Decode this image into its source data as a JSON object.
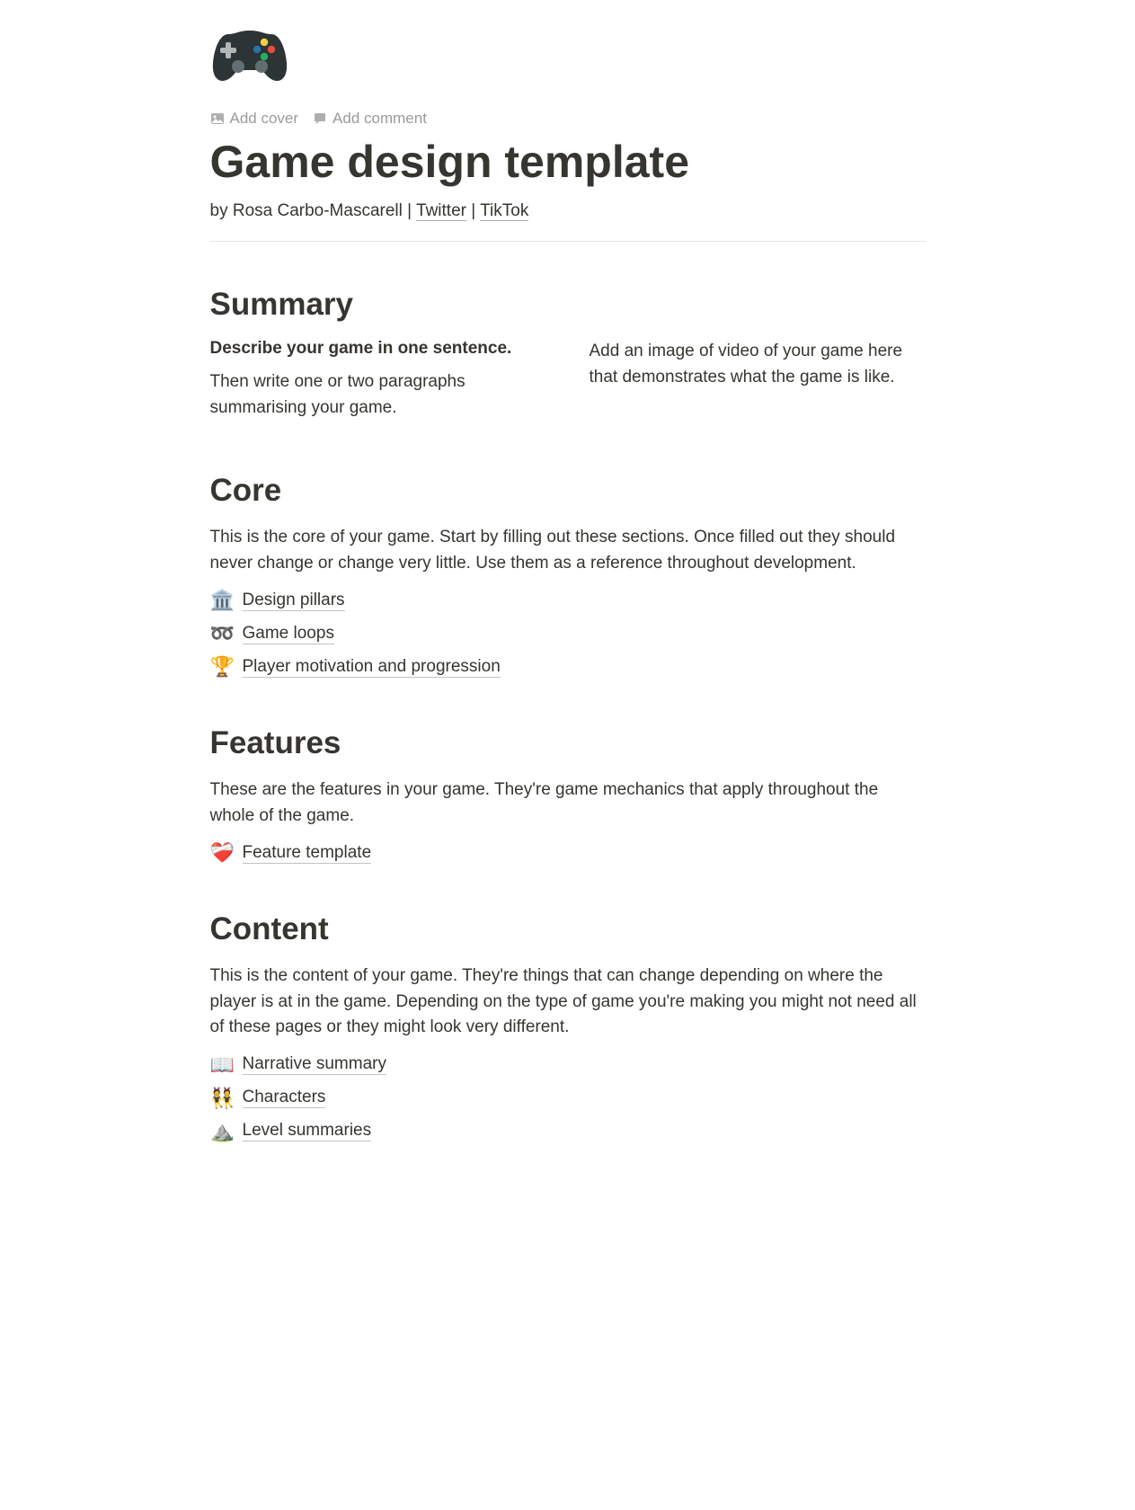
{
  "icon_name": "video-game-controller",
  "actions": {
    "add_cover": "Add cover",
    "add_comment": "Add comment"
  },
  "title": "Game design template",
  "byline": {
    "prefix": "by Rosa Carbo-Mascarell | ",
    "link1": "Twitter",
    "sep": " | ",
    "link2": "TikTok"
  },
  "sections": {
    "summary": {
      "heading": "Summary",
      "left_strong": "Describe your game in one sentence.",
      "left_body": "Then write one or two paragraphs summarising your game.",
      "right_body": "Add an image of video of your game here that demonstrates what the game is like."
    },
    "core": {
      "heading": "Core",
      "body": "This is the core of your game. Start by filling out these sections. Once filled out they should never change or change very little. Use them as a reference throughout development.",
      "links": [
        {
          "emoji": "🏛️",
          "label": "Design pillars"
        },
        {
          "emoji": "➿",
          "label": "Game loops"
        },
        {
          "emoji": "🏆",
          "label": "Player motivation and progression"
        }
      ]
    },
    "features": {
      "heading": "Features",
      "body": "These are the features in your game. They're game mechanics that apply throughout the whole of the game.",
      "links": [
        {
          "emoji": "❤️‍🩹",
          "label": "Feature template"
        }
      ]
    },
    "content": {
      "heading": "Content",
      "body": "This is the content of your game. They're things that can change depending on where the player is at in the game. Depending on the type of game you're making you might not need all of these pages or they might look very different.",
      "links": [
        {
          "emoji": "📖",
          "label": "Narrative summary"
        },
        {
          "emoji": "👯",
          "label": "Characters"
        },
        {
          "emoji": "⛰️",
          "label": "Level summaries"
        }
      ]
    }
  }
}
